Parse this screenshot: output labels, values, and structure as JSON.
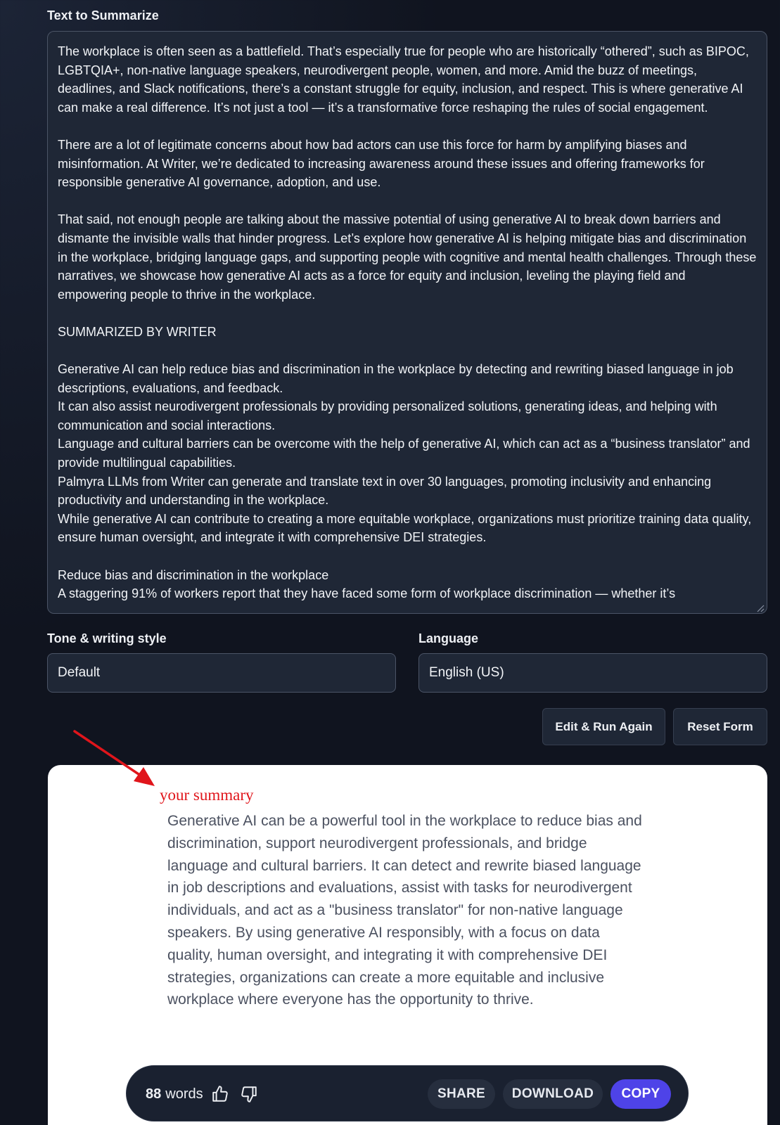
{
  "form": {
    "text_label": "Text to Summarize",
    "text_value": "The workplace is often seen as a battlefield. That’s especially true for people who are historically “othered”, such as BIPOC, LGBTQIA+, non-native language speakers, neurodivergent people, women, and more. Amid the buzz of meetings, deadlines, and Slack notifications, there’s a constant struggle for equity, inclusion, and respect. This is where generative AI can make a real difference. It’s not just a tool — it’s a transformative force reshaping the rules of social engagement.\n\nThere are a lot of legitimate concerns about how bad actors can use this force for harm by amplifying biases and misinformation. At Writer, we’re dedicated to increasing awareness around these issues and offering frameworks for responsible generative AI governance, adoption, and use.\n\nThat said, not enough people are talking about the massive potential of using generative AI to break down barriers and dismante the invisible walls that hinder progress. Let’s explore how generative AI is helping mitigate bias and discrimination in the workplace, bridging language gaps, and supporting people with cognitive and mental health challenges. Through these narratives, we showcase how generative AI acts as a force for equity and inclusion, leveling the playing field and empowering people to thrive in the workplace.\n\nSUMMARIZED BY WRITER\n\nGenerative AI can help reduce bias and discrimination in the workplace by detecting and rewriting biased language in job descriptions, evaluations, and feedback.\nIt can also assist neurodivergent professionals by providing personalized solutions, generating ideas, and helping with communication and social interactions.\nLanguage and cultural barriers can be overcome with the help of generative AI, which can act as a “business translator” and provide multilingual capabilities.\nPalmyra LLMs from Writer can generate and translate text in over 30 languages, promoting inclusivity and enhancing productivity and understanding in the workplace.\nWhile generative AI can contribute to creating a more equitable workplace, organizations must prioritize training data quality, ensure human oversight, and integrate it with comprehensive DEI strategies.\n\nReduce bias and discrimination in the workplace\nA staggering 91% of workers report that they have faced some form of workplace discrimination — whether it’s",
    "tone_label": "Tone & writing style",
    "tone_value": "Default",
    "language_label": "Language",
    "language_value": "English (US)",
    "edit_button": "Edit & Run Again",
    "reset_button": "Reset Form"
  },
  "result": {
    "annotation": "your summary",
    "summary": "Generative AI can be a powerful tool in the workplace to reduce bias and discrimination, support neurodivergent professionals, and bridge language and cultural barriers. It can detect and rewrite biased language in job descriptions and evaluations, assist with tasks for neurodivergent individuals, and act as a \"business translator\" for non-native language speakers. By using generative AI responsibly, with a focus on data quality, human oversight, and integrating it with comprehensive DEI strategies, organizations can create a more equitable and inclusive workplace where everyone has the opportunity to thrive.",
    "toolbar": {
      "word_count": "88",
      "word_unit": "words",
      "share": "SHARE",
      "download": "DOWNLOAD",
      "copy": "COPY"
    }
  },
  "colors": {
    "page_bg": "#10141f",
    "field_bg": "#1f2736",
    "annotation_red": "#e0151b",
    "copy_button": "#4e43e8"
  },
  "icons": [
    "thumbs-up-icon",
    "thumbs-down-icon",
    "red-arrow-annotation"
  ]
}
